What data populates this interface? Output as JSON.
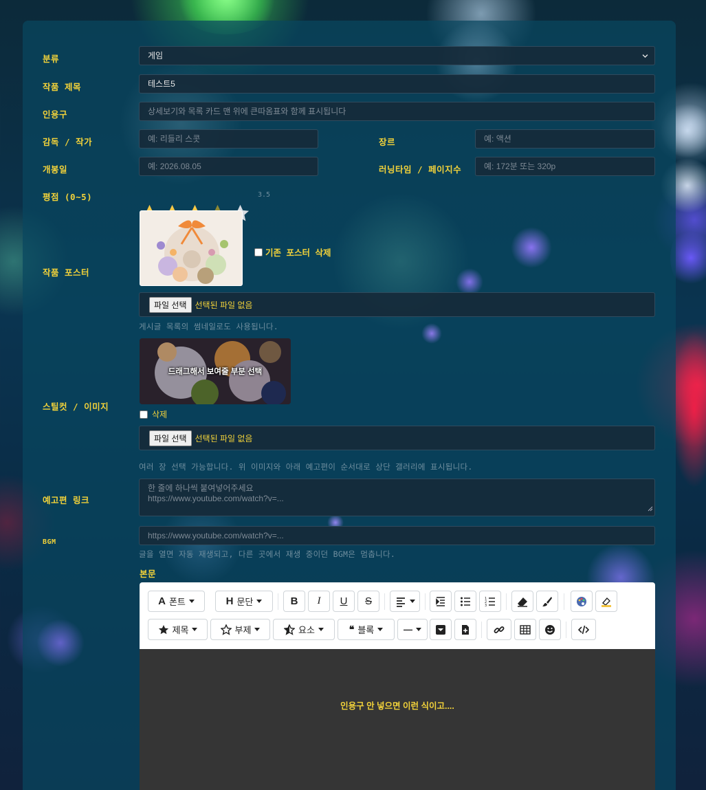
{
  "form": {
    "category": {
      "label": "분류",
      "value": "게임"
    },
    "title": {
      "label": "작품 제목",
      "value": "테스트5"
    },
    "quote": {
      "label": "인용구",
      "placeholder": "상세보기와 목록 카드 맨 위에 큰따옴표와 함께 표시됩니다"
    },
    "director": {
      "label": "감독 / 작가",
      "placeholder": "예: 리들리 스콧"
    },
    "genre": {
      "label": "장르",
      "placeholder": "예: 액션"
    },
    "release": {
      "label": "개봉일",
      "placeholder": "예: 2026.08.05"
    },
    "runtime": {
      "label": "러닝타임 / 페이지수",
      "placeholder": "예: 172분 또는 320p"
    },
    "rating": {
      "label": "평점 (0~5)",
      "value": 3.5,
      "display": "3.5"
    },
    "poster": {
      "label": "작품 포스터",
      "delete_label": "기존 포스터 삭제",
      "file_button": "파일 선택",
      "file_status": "선택된 파일 없음",
      "hint": "게시글 목록의 썸네일로도 사용됩니다."
    },
    "stills": {
      "label": "스틸컷 / 이미지",
      "overlay": "드래그해서 보여줄 부분 선택",
      "delete_label": "삭제",
      "file_button": "파일 선택",
      "file_status": "선택된 파일 없음",
      "hint": "여러 장 선택 가능합니다. 위 이미지와 아래 예고편이 순서대로 상단 갤러리에 표시됩니다."
    },
    "trailer": {
      "label": "예고편 링크",
      "placeholder_line1": "한 줄에 하나씩 붙여넣어주세요",
      "placeholder_line2": "https://www.youtube.com/watch?v=..."
    },
    "bgm": {
      "label": "BGM",
      "placeholder": "https://www.youtube.com/watch?v=...",
      "hint": "글을 열면 자동 재생되고, 다른 곳에서 재생 중이던 BGM은 멈춥니다."
    },
    "body": {
      "label": "본문",
      "content": "인용구 안 넣으면 이런 식이고...."
    }
  },
  "toolbar": {
    "font": "폰트",
    "paragraph": "문단",
    "heading": "제목",
    "subtitle": "부제",
    "element": "요소",
    "block": "블록",
    "font_glyph": "A",
    "paragraph_glyph": "H",
    "bold_glyph": "B",
    "italic_glyph": "I",
    "underline_glyph": "U",
    "strike_glyph": "S",
    "quote_glyph": "❝",
    "hr_glyph": "—"
  },
  "colors": {
    "accent": "#f2d23a",
    "panel": "#08465f",
    "field": "#162a3a",
    "editor": "#353535"
  }
}
